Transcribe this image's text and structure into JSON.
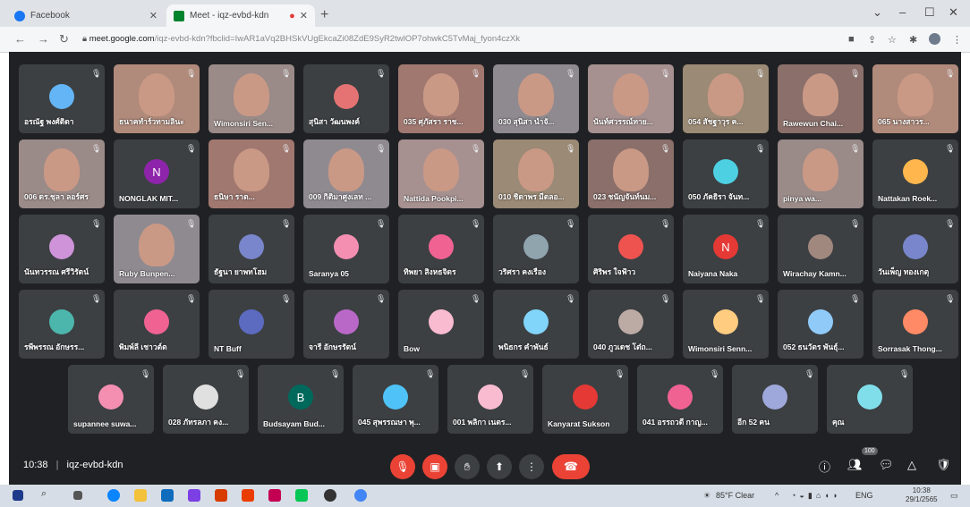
{
  "browser": {
    "tabs": [
      {
        "title": "Facebook",
        "favicon_color": "#1877f2"
      },
      {
        "title": "Meet - iqz-evbd-kdn",
        "favicon_color": "#00832d"
      }
    ],
    "url_host": "meet.google.com",
    "url_path": "/iqz-evbd-kdn?fbclid=IwAR1aVq2BHSkVUgEkcaZi08ZdE9SyR2twlOP7ohwkC5TvMaj_fyon4czXk",
    "icons": [
      "back-icon",
      "forward-icon",
      "reload-icon",
      "lock-icon",
      "camera-icon",
      "share-icon",
      "star-icon",
      "extensions-icon",
      "profile-icon",
      "menu-icon"
    ]
  },
  "meet": {
    "rows": [
      [
        {
          "name": "อรณัฐ พงศ์ติดา",
          "kind": "avatar",
          "color": "#64b5f6"
        },
        {
          "name": "ธนาคทำร์วทามลินะ",
          "kind": "video"
        },
        {
          "name": "Wimonsiri Sen...",
          "kind": "video"
        },
        {
          "name": "สุนิสา วัฒนพงค์",
          "kind": "avatar",
          "color": "#e57373"
        },
        {
          "name": "035 ศุภัสรา ราช...",
          "kind": "video"
        },
        {
          "name": "030 สุนิสา นำจั...",
          "kind": "video"
        },
        {
          "name": "นันท์ศวรรณ์ทาย...",
          "kind": "video"
        },
        {
          "name": "054 สัชฐาวุร ค...",
          "kind": "video"
        },
        {
          "name": "Rawewun Chai...",
          "kind": "video"
        },
        {
          "name": "065 นางสาวร...",
          "kind": "video"
        }
      ],
      [
        {
          "name": "006 ดร.ชุลา ลอร์ศร",
          "kind": "video"
        },
        {
          "name": "NONGLAK MIT...",
          "kind": "letter",
          "letter": "N",
          "color": "#8e24aa"
        },
        {
          "name": "ธนิษา ราต...",
          "kind": "video"
        },
        {
          "name": "009 กิติมาศูงเลท ...",
          "kind": "video"
        },
        {
          "name": "Nattida Pookpi...",
          "kind": "video"
        },
        {
          "name": "010 ชิดาพร มีตลอ...",
          "kind": "video"
        },
        {
          "name": "023 ชนัญจันท์นม...",
          "kind": "video"
        },
        {
          "name": "050 ภัคธิรา จันท...",
          "kind": "avatar",
          "color": "#4dd0e1"
        },
        {
          "name": "pinya wa...",
          "kind": "video"
        },
        {
          "name": "Nattakan Roek...",
          "kind": "avatar",
          "color": "#ffb74d"
        }
      ],
      [
        {
          "name": "นันทวรรณ ศรีวิรัตน์",
          "kind": "avatar",
          "color": "#ce93d8"
        },
        {
          "name": "Ruby Bunpen...",
          "kind": "video"
        },
        {
          "name": "ธัฐนา ยาพทโฮม",
          "kind": "avatar",
          "color": "#7986cb"
        },
        {
          "name": "Saranya 05",
          "kind": "avatar",
          "color": "#f48fb1"
        },
        {
          "name": "ทิพยา สิงหธจิดร",
          "kind": "avatar",
          "color": "#f06292"
        },
        {
          "name": "วริศรา คงเรือง",
          "kind": "avatar",
          "color": "#90a4ae"
        },
        {
          "name": "ศิริพร ใจฟ้าว",
          "kind": "avatar",
          "color": "#ef5350"
        },
        {
          "name": "Naiyana Naka",
          "kind": "letter",
          "letter": "N",
          "color": "#e53935"
        },
        {
          "name": "Wirachay Kamn...",
          "kind": "avatar",
          "color": "#a1887f"
        },
        {
          "name": "วันเพ็ญ ทองเกตุ",
          "kind": "avatar",
          "color": "#7986cb"
        }
      ],
      [
        {
          "name": "รพีพรรณ อักษรร...",
          "kind": "avatar",
          "color": "#4db6ac"
        },
        {
          "name": "พิมพ์ลี เชาวต์ต",
          "kind": "avatar",
          "color": "#f06292"
        },
        {
          "name": "NT Buff",
          "kind": "avatar",
          "color": "#5c6bc0"
        },
        {
          "name": "จารี อักษรรัตน์",
          "kind": "avatar",
          "color": "#ba68c8"
        },
        {
          "name": "Bow",
          "kind": "avatar",
          "color": "#f8bbd0"
        },
        {
          "name": "พนิธกร คำพันธ์",
          "kind": "avatar",
          "color": "#81d4fa"
        },
        {
          "name": "040 ภูวเดช โต๋ถ...",
          "kind": "avatar",
          "color": "#bcaaa4"
        },
        {
          "name": "Wimonsiri Senn...",
          "kind": "avatar",
          "color": "#ffcc80"
        },
        {
          "name": "052 ธนวัตร พันธุ์...",
          "kind": "avatar",
          "color": "#90caf9"
        },
        {
          "name": "Sorrasak Thong...",
          "kind": "avatar",
          "color": "#ff8a65"
        }
      ],
      [
        {
          "name": "supannee suwa...",
          "kind": "avatar",
          "color": "#f48fb1"
        },
        {
          "name": "028 ภัทรลภา คง...",
          "kind": "avatar",
          "color": "#e0e0e0"
        },
        {
          "name": "Budsayam Bud...",
          "kind": "letter",
          "letter": "B",
          "color": "#00695c"
        },
        {
          "name": "045 สุพรรณษา พุ...",
          "kind": "avatar",
          "color": "#4fc3f7"
        },
        {
          "name": "001 พลิกา เนตร...",
          "kind": "avatar",
          "color": "#f8bbd0"
        },
        {
          "name": "Kanyarat Sukson",
          "kind": "avatar",
          "color": "#e53935"
        },
        {
          "name": "041 อรรถวดี กาญ...",
          "kind": "avatar",
          "color": "#f06292"
        },
        {
          "name": "อีก 52 คน",
          "kind": "group",
          "color": "#9fa8da"
        },
        {
          "name": "คุณ",
          "kind": "avatar",
          "color": "#80deea"
        }
      ]
    ],
    "bottom": {
      "time": "10:38",
      "separator": "|",
      "meeting_code": "iqz-evbd-kdn",
      "participant_badge": "100",
      "controls": [
        "mic-off-icon",
        "camera-off-icon",
        "raise-hand-icon",
        "present-icon",
        "more-options-icon",
        "end-call-icon"
      ]
    }
  },
  "taskbar": {
    "weather": "85°F Clear",
    "lang": "ENG",
    "clock_time": "10:38",
    "clock_date": "29/1/2565"
  }
}
